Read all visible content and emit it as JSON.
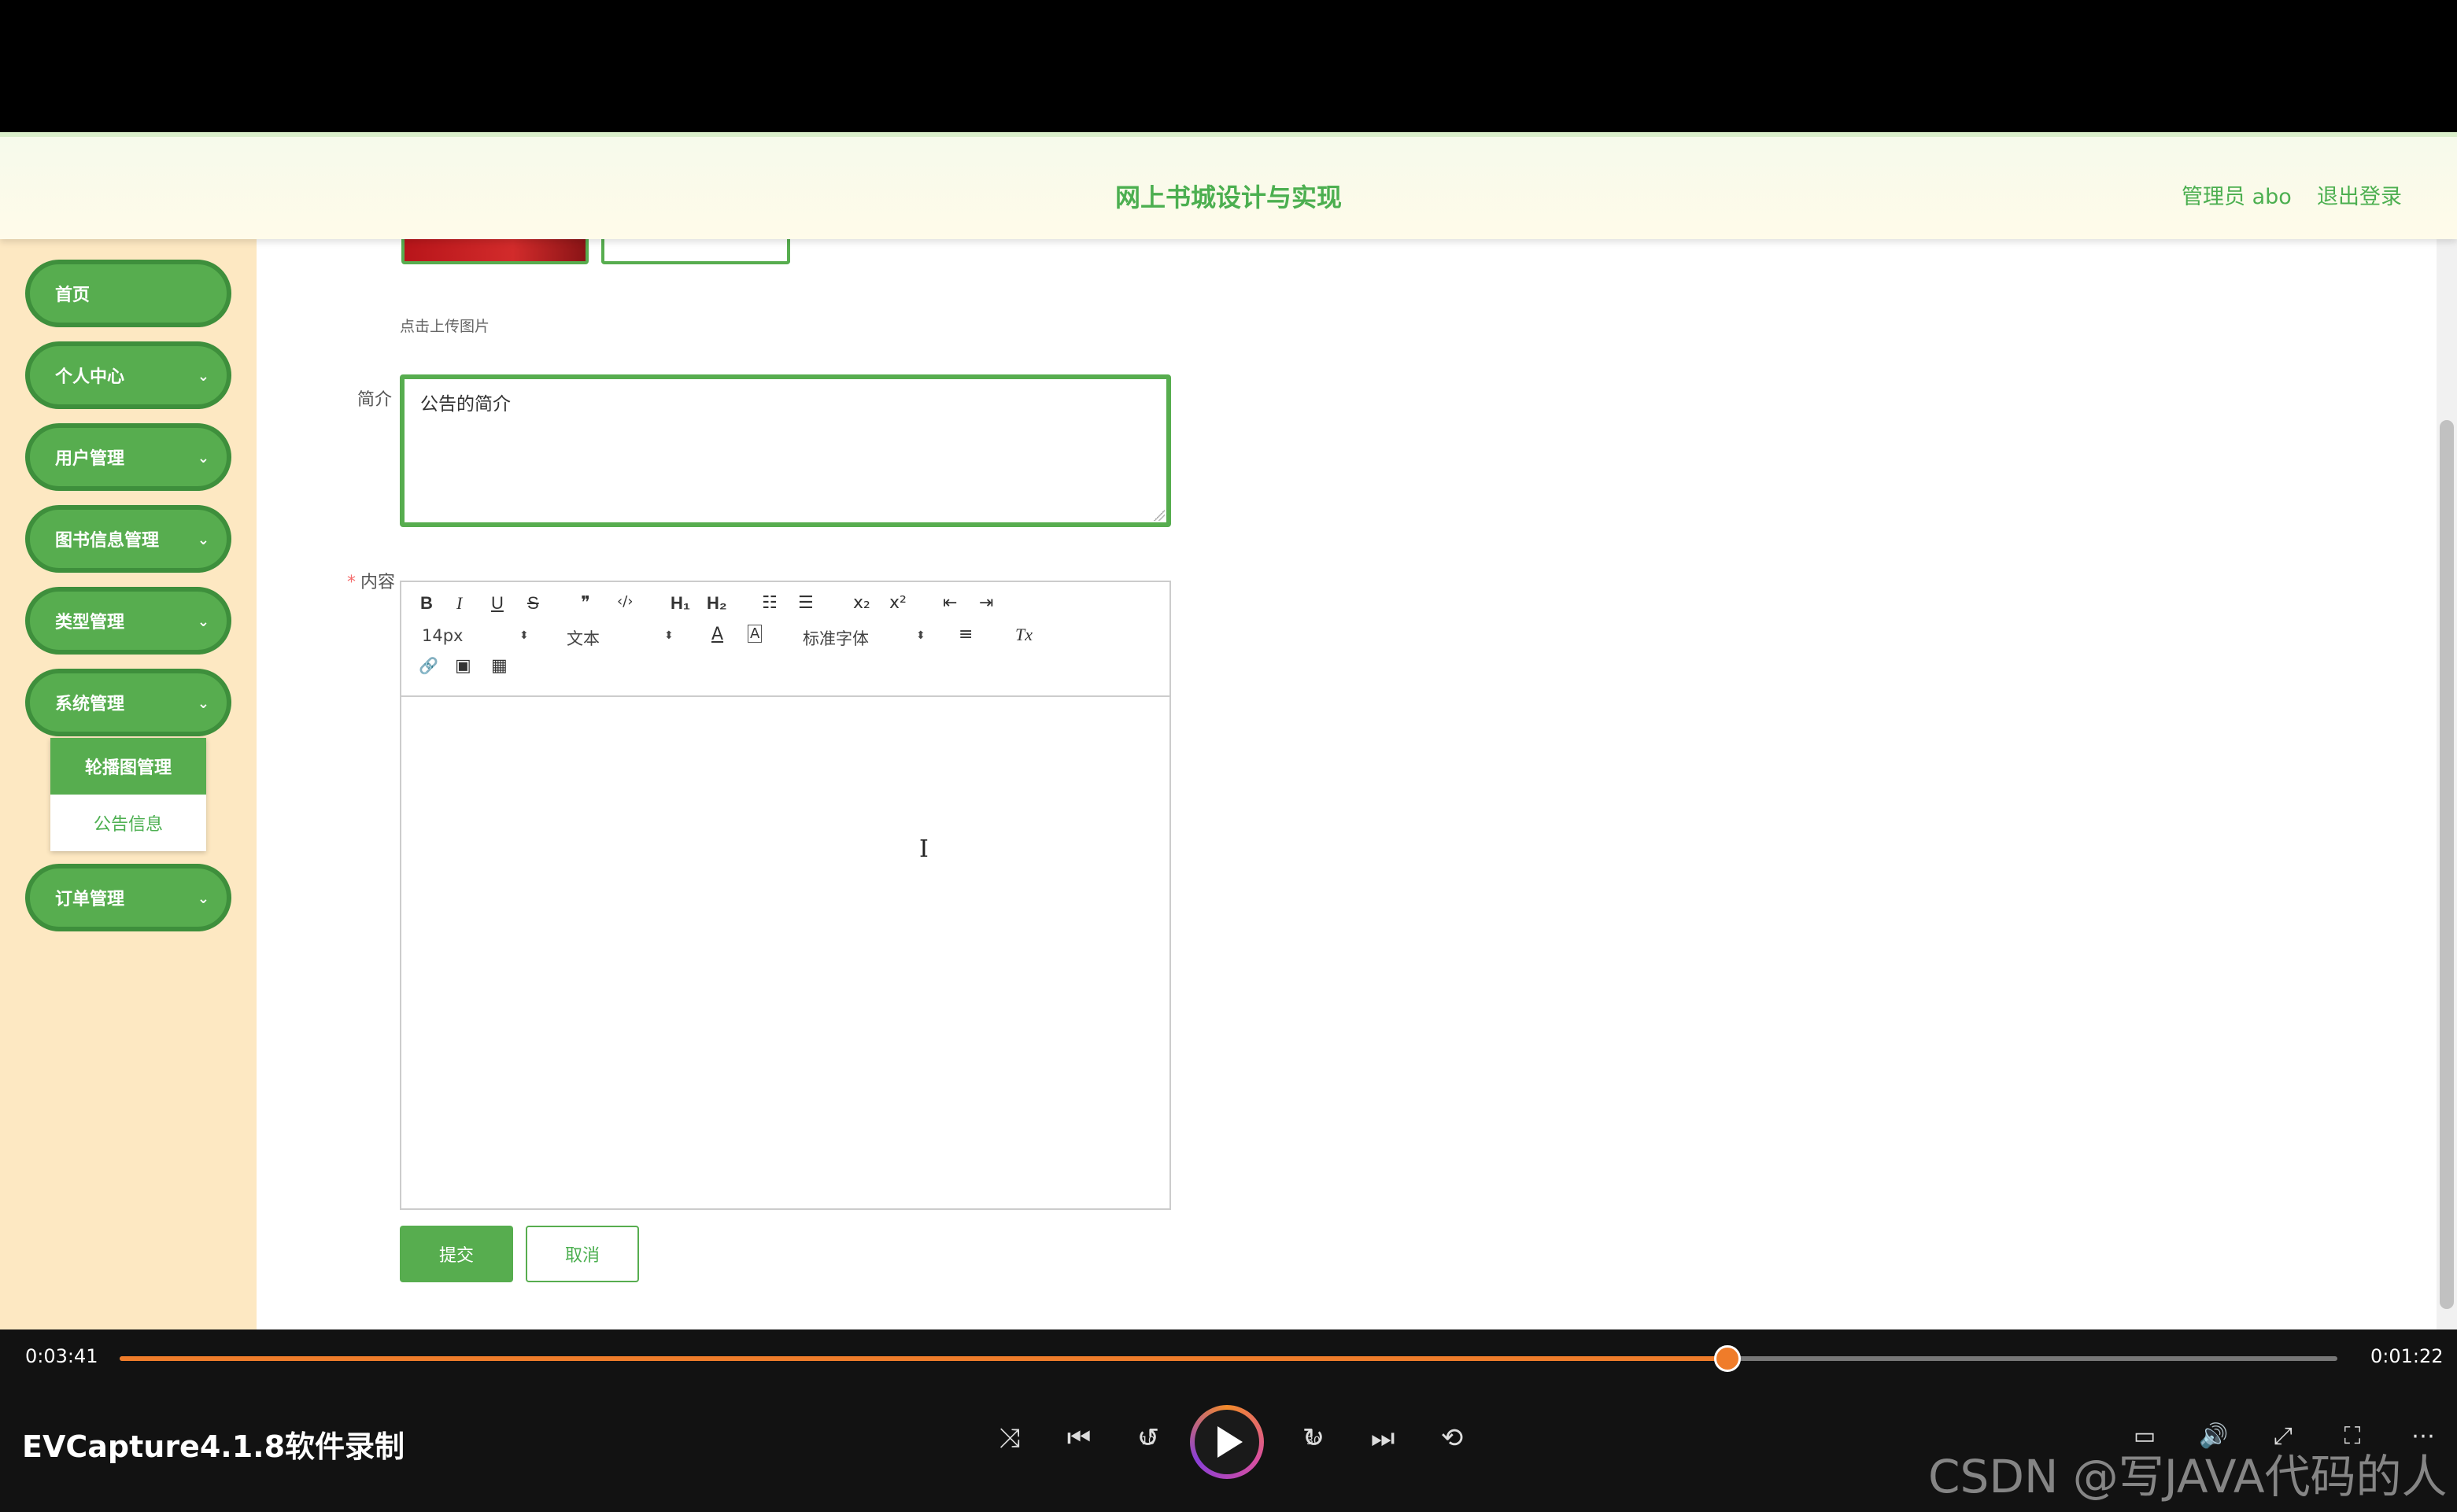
{
  "header": {
    "title": "网上书城设计与实现",
    "admin": "管理员 abo",
    "logout": "退出登录"
  },
  "sidebar": {
    "items": [
      {
        "label": "首页",
        "has_chevron": false
      },
      {
        "label": "个人中心",
        "has_chevron": true
      },
      {
        "label": "用户管理",
        "has_chevron": true
      },
      {
        "label": "图书信息管理",
        "has_chevron": true
      },
      {
        "label": "类型管理",
        "has_chevron": true
      },
      {
        "label": "系统管理",
        "has_chevron": true,
        "expanded": true
      },
      {
        "label": "订单管理",
        "has_chevron": true
      }
    ],
    "submenu": [
      {
        "label": "轮播图管理",
        "active": true
      },
      {
        "label": "公告信息",
        "active": false
      }
    ],
    "chevron_glyph": "⌄"
  },
  "form": {
    "upload_hint": "点击上传图片",
    "intro_label": "简介",
    "intro_value": "公告的简介",
    "content_label": "内容",
    "required_mark": "*",
    "editor": {
      "font_size": "14px",
      "header_select": "文本",
      "font_family": "标准字体",
      "buttons": {
        "bold": "B",
        "italic": "I",
        "underline": "U",
        "strike": "S",
        "quote": "❞",
        "code": "‹/›",
        "h1": "H₁",
        "h2": "H₂",
        "ol": "☷",
        "ul": "☰",
        "sub": "x₂",
        "sup": "x²",
        "outdent": "⇤",
        "indent": "⇥",
        "color": "A",
        "background": "A",
        "align": "≡",
        "clean": "Tx",
        "link": "🔗",
        "image": "▣",
        "video": "▦"
      },
      "caret": "I"
    },
    "submit": "提交",
    "cancel": "取消"
  },
  "player": {
    "elapsed": "0:03:41",
    "remaining": "0:01:22",
    "progress": 0.725,
    "recorder_title": "EVCapture4.1.8软件录制",
    "icons": {
      "shuffle": "⤨",
      "prev": "⏮",
      "back10": "↺",
      "fwd30": "↻",
      "next": "⏭",
      "repeat": "⟲",
      "subtitles": "▭",
      "volume": "🔊",
      "expand": "⤢",
      "fullscreen": "⛶",
      "more": "⋯"
    },
    "back10_label": "10",
    "fwd30_label": "30"
  },
  "watermark": "CSDN @写JAVA代码的人",
  "colors": {
    "accent": "#57ad4f",
    "accent_text": "#4caf50",
    "sidebar_bg": "#fde8c2",
    "progress": "#ef7c2a"
  }
}
